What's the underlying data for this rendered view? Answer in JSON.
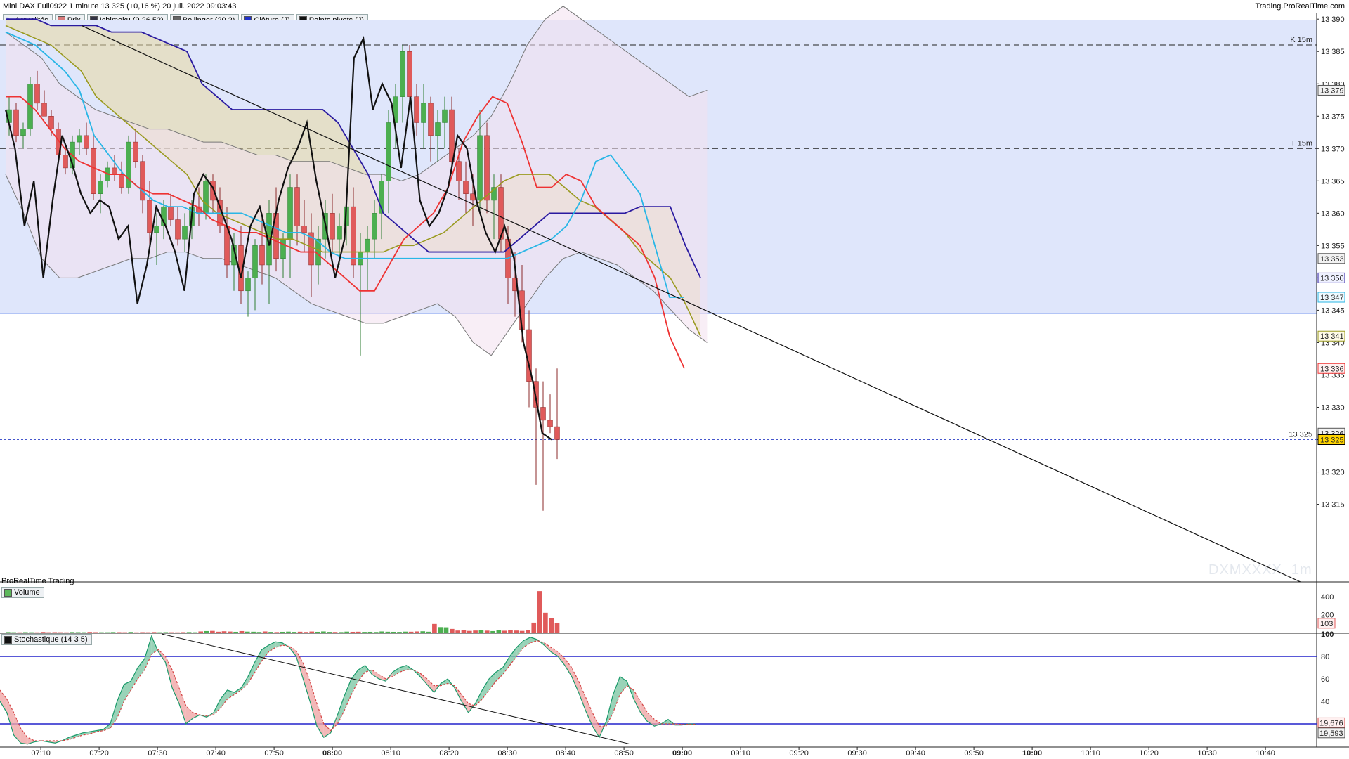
{
  "header": {
    "title": "Mini DAX Full0922 1 minute 13 325 (+0,16 %) 20 juil. 2022 09:03:43",
    "site": "Trading.ProRealTime.com"
  },
  "legend": [
    {
      "label": "Actualités",
      "icon": "refresh-icon",
      "color": "#4a8ad6"
    },
    {
      "label": "Prix",
      "icon": "price-swatch",
      "color": "#d97b7b"
    },
    {
      "label": "Ichimoku (9 26 52)",
      "icon": "ichimoku-swatch",
      "color": "#334"
    },
    {
      "label": "Bollinger (20 2)",
      "icon": "bollinger-swatch",
      "color": "#666666"
    },
    {
      "label": "Clôture (J)",
      "icon": "close-swatch",
      "color": "#2233cc"
    },
    {
      "label": "Points pivots (J)",
      "icon": "pivot-swatch",
      "color": "#111111"
    }
  ],
  "panels": {
    "brand": "ProRealTime Trading",
    "volume_label": "Volume",
    "stoch_label": "Stochastique (14 3 5)"
  },
  "watermark": "DXMXXXX, 1m",
  "levels": {
    "k15": {
      "label": "K 15m",
      "value": 13386
    },
    "t15": {
      "label": "T 15m",
      "value": 13370
    },
    "last": {
      "label": "13 325",
      "value": 13325
    }
  },
  "colors": {
    "up": "#4caf50",
    "down": "#e05a5a",
    "tenkan": "#ee3333",
    "kijun": "#29b6e6",
    "ssa": "#9a9a20",
    "ssb": "#2a1aa0",
    "chikou": "#111111",
    "bollinger": "#777777",
    "stoch_k": "#1a9a6a",
    "stoch_d": "#d44444",
    "band_bg": "#dfe6fb",
    "band_line": "#6688ee"
  },
  "chart_data": [
    {
      "type": "candlestick",
      "title": "Mini DAX Full0922 1 minute",
      "y_ticks": [
        "13 315",
        "13 320",
        "13 325",
        "13 330",
        "13 335",
        "13 340",
        "13 345",
        "13 350",
        "13 355",
        "13 360",
        "13 365",
        "13 370",
        "13 375",
        "13 380",
        "13 385",
        "13 390"
      ],
      "x_ticks": [
        "07:10",
        "07:20",
        "07:30",
        "07:40",
        "07:50",
        "08:00",
        "08:10",
        "08:20",
        "08:30",
        "08:40",
        "08:50",
        "09:00",
        "09:10",
        "09:20",
        "09:30",
        "09:40",
        "09:50",
        "10:00",
        "10:10",
        "10:20",
        "10:30",
        "10:40"
      ],
      "ylim": [
        13303,
        13391
      ],
      "last_price": 13325,
      "price_tags": [
        {
          "text": "13 379",
          "value": 13379,
          "color": "#555555",
          "bg": "#f2f2f2"
        },
        {
          "text": "13 353",
          "value": 13353,
          "color": "#555555",
          "bg": "#f2f2f2"
        },
        {
          "text": "13 350",
          "value": 13350,
          "color": "#2a1aa0",
          "bg": "#eef0ff"
        },
        {
          "text": "13 347",
          "value": 13347,
          "color": "#29b6e6",
          "bg": "#eefaff"
        },
        {
          "text": "13 341",
          "value": 13341,
          "color": "#9a9a20",
          "bg": "#fffbe8"
        },
        {
          "text": "13 336",
          "value": 13336,
          "color": "#ee3333",
          "bg": "#fff0f0"
        },
        {
          "text": "13 326",
          "value": 13326,
          "color": "#555555",
          "bg": "#f2f2f2"
        },
        {
          "text": "13 325",
          "value": 13325,
          "color": "#000000",
          "bg": "#ffd400"
        }
      ],
      "trendline": {
        "from": [
          "07:17",
          13389
        ],
        "to": [
          "10:46",
          13303
        ]
      },
      "tenkan": [
        13378,
        13378,
        13376,
        13373,
        13370,
        13368,
        13367,
        13366,
        13366,
        13364,
        13363,
        13363,
        13362,
        13361,
        13359,
        13358,
        13357,
        13357,
        13356,
        13355,
        13354,
        13354,
        13352,
        13350,
        13348,
        13348,
        13352,
        13356,
        13358,
        13360,
        13364,
        13371,
        13375,
        13378,
        13377,
        13371,
        13364,
        13364,
        13366,
        13365,
        13361,
        13359,
        13357,
        13355,
        13350,
        13341,
        13336
      ],
      "kijun": [
        13388,
        13387,
        13386,
        13384,
        13382,
        13379,
        13372,
        13369,
        13366,
        13364,
        13362,
        13361,
        13361,
        13360,
        13360,
        13360,
        13360,
        13359,
        13358,
        13357,
        13357,
        13356,
        13354,
        13353,
        13353,
        13353,
        13353,
        13353,
        13353,
        13353,
        13353,
        13353,
        13353,
        13353,
        13353,
        13354,
        13355,
        13356,
        13358,
        13362,
        13368,
        13369,
        13366,
        13363,
        13355,
        13347,
        13347
      ],
      "ssa": [
        13389,
        13388,
        13387,
        13386,
        13384,
        13382,
        13378,
        13376,
        13374,
        13372,
        13370,
        13368,
        13366,
        13362,
        13360,
        13359,
        13358,
        13357,
        13356,
        13356,
        13355,
        13354,
        13354,
        13354,
        13354,
        13354,
        13355,
        13355,
        13356,
        13357,
        13359,
        13361,
        13363,
        13365,
        13366,
        13366,
        13366,
        13364,
        13362,
        13361,
        13359,
        13357,
        13354,
        13352,
        13350,
        13346,
        13341
      ],
      "ssb": [
        13390,
        13390,
        13390,
        13389,
        13389,
        13389,
        13389,
        13388,
        13388,
        13388,
        13387,
        13386,
        13385,
        13380,
        13378,
        13376,
        13376,
        13376,
        13376,
        13376,
        13376,
        13376,
        13374,
        13370,
        13366,
        13360,
        13358,
        13356,
        13354,
        13354,
        13354,
        13354,
        13354,
        13354,
        13356,
        13358,
        13360,
        13360,
        13360,
        13360,
        13360,
        13360,
        13361,
        13361,
        13361,
        13355,
        13350
      ],
      "chikou_close": [
        13376,
        13370,
        13358,
        13365,
        13350,
        13362,
        13372,
        13368,
        13363,
        13360,
        13362,
        13361,
        13356,
        13358,
        13346,
        13352,
        13361,
        13358,
        13354,
        13348,
        13363,
        13366,
        13364,
        13360,
        13356,
        13350,
        13358,
        13361,
        13355,
        13362,
        13367,
        13370,
        13374,
        13365,
        13358,
        13350,
        13356,
        13384,
        13387,
        13376,
        13380,
        13377,
        13367,
        13378,
        13362,
        13358,
        13360,
        13364,
        13372,
        13370,
        13362,
        13357,
        13354,
        13358,
        13353,
        13340,
        13334,
        13326,
        13325
      ],
      "bollinger_upper": [
        13388,
        13386,
        13384,
        13380,
        13378,
        13376,
        13375,
        13374,
        13373,
        13373,
        13372,
        13371,
        13371,
        13370,
        13369,
        13369,
        13368,
        13368,
        13368,
        13367,
        13366,
        13366,
        13365,
        13366,
        13368,
        13370,
        13372,
        13375,
        13380,
        13386,
        13390,
        13392,
        13390,
        13388,
        13386,
        13384,
        13382,
        13380,
        13378,
        13379
      ],
      "bollinger_lower": [
        13366,
        13360,
        13353,
        13350,
        13350,
        13351,
        13352,
        13353,
        13353,
        13354,
        13354,
        13353,
        13353,
        13352,
        13351,
        13350,
        13348,
        13346,
        13345,
        13344,
        13343,
        13343,
        13344,
        13345,
        13346,
        13344,
        13340,
        13338,
        13342,
        13346,
        13350,
        13353,
        13354,
        13353,
        13352,
        13350,
        13348,
        13345,
        13342,
        13340
      ],
      "candles_ohlc": [
        [
          13374,
          13378,
          13372,
          13376
        ],
        [
          13376,
          13377,
          13371,
          13372
        ],
        [
          13372,
          13374,
          13370,
          13373
        ],
        [
          13373,
          13381,
          13372,
          13380
        ],
        [
          13380,
          13382,
          13376,
          13377
        ],
        [
          13377,
          13379,
          13375,
          13375
        ],
        [
          13375,
          13376,
          13372,
          13373
        ],
        [
          13373,
          13374,
          13368,
          13369
        ],
        [
          13369,
          13370,
          13366,
          13367
        ],
        [
          13367,
          13372,
          13366,
          13371
        ],
        [
          13371,
          13373,
          13369,
          13372
        ],
        [
          13372,
          13374,
          13369,
          13370
        ],
        [
          13370,
          13372,
          13362,
          13363
        ],
        [
          13363,
          13366,
          13360,
          13365
        ],
        [
          13365,
          13368,
          13364,
          13367
        ],
        [
          13367,
          13369,
          13365,
          13366
        ],
        [
          13366,
          13368,
          13363,
          13364
        ],
        [
          13364,
          13372,
          13363,
          13371
        ],
        [
          13371,
          13373,
          13367,
          13368
        ],
        [
          13368,
          13369,
          13360,
          13362
        ],
        [
          13362,
          13365,
          13355,
          13357
        ],
        [
          13357,
          13360,
          13352,
          13358
        ],
        [
          13358,
          13362,
          13356,
          13361
        ],
        [
          13361,
          13363,
          13358,
          13359
        ],
        [
          13359,
          13361,
          13355,
          13356
        ],
        [
          13356,
          13360,
          13354,
          13358
        ],
        [
          13358,
          13362,
          13356,
          13361
        ],
        [
          13361,
          13364,
          13358,
          13360
        ],
        [
          13360,
          13366,
          13359,
          13365
        ],
        [
          13365,
          13366,
          13360,
          13362
        ],
        [
          13362,
          13364,
          13357,
          13358
        ],
        [
          13358,
          13361,
          13350,
          13352
        ],
        [
          13352,
          13357,
          13348,
          13355
        ],
        [
          13355,
          13358,
          13346,
          13348
        ],
        [
          13348,
          13351,
          13344,
          13350
        ],
        [
          13350,
          13356,
          13345,
          13355
        ],
        [
          13355,
          13360,
          13349,
          13352
        ],
        [
          13352,
          13362,
          13346,
          13360
        ],
        [
          13360,
          13364,
          13351,
          13353
        ],
        [
          13353,
          13357,
          13350,
          13356
        ],
        [
          13356,
          13366,
          13350,
          13364
        ],
        [
          13364,
          13366,
          13355,
          13358
        ],
        [
          13358,
          13362,
          13354,
          13357
        ],
        [
          13357,
          13360,
          13347,
          13352
        ],
        [
          13352,
          13358,
          13349,
          13356
        ],
        [
          13356,
          13362,
          13353,
          13360
        ],
        [
          13360,
          13363,
          13354,
          13356
        ],
        [
          13356,
          13360,
          13352,
          13358
        ],
        [
          13358,
          13362,
          13355,
          13361
        ],
        [
          13361,
          13364,
          13350,
          13352
        ],
        [
          13352,
          13357,
          13338,
          13354
        ],
        [
          13354,
          13358,
          13348,
          13356
        ],
        [
          13356,
          13362,
          13353,
          13360
        ],
        [
          13360,
          13366,
          13356,
          13365
        ],
        [
          13365,
          13376,
          13360,
          13374
        ],
        [
          13374,
          13380,
          13370,
          13378
        ],
        [
          13378,
          13386,
          13374,
          13385
        ],
        [
          13385,
          13386,
          13376,
          13378
        ],
        [
          13378,
          13380,
          13372,
          13374
        ],
        [
          13374,
          13380,
          13370,
          13377
        ],
        [
          13377,
          13378,
          13368,
          13372
        ],
        [
          13372,
          13376,
          13368,
          13374
        ],
        [
          13374,
          13378,
          13370,
          13376
        ],
        [
          13376,
          13378,
          13366,
          13368
        ],
        [
          13368,
          13370,
          13362,
          13365
        ],
        [
          13365,
          13368,
          13360,
          13363
        ],
        [
          13363,
          13366,
          13358,
          13362
        ],
        [
          13362,
          13376,
          13360,
          13372
        ],
        [
          13372,
          13374,
          13360,
          13362
        ],
        [
          13362,
          13366,
          13356,
          13364
        ],
        [
          13364,
          13366,
          13354,
          13356
        ],
        [
          13356,
          13358,
          13346,
          13350
        ],
        [
          13350,
          13354,
          13344,
          13348
        ],
        [
          13348,
          13352,
          13340,
          13342
        ],
        [
          13342,
          13345,
          13330,
          13334
        ],
        [
          13334,
          13336,
          13318,
          13330
        ],
        [
          13330,
          13334,
          13314,
          13328
        ],
        [
          13328,
          13332,
          13326,
          13327
        ],
        [
          13327,
          13336,
          13322,
          13325
        ]
      ]
    },
    {
      "type": "bar",
      "title": "Volume",
      "y_ticks": [
        "200",
        "400"
      ],
      "last_value_tag": "103",
      "values": [
        5,
        3,
        2,
        4,
        3,
        2,
        6,
        3,
        4,
        3,
        2,
        5,
        4,
        3,
        6,
        4,
        3,
        3,
        5,
        4,
        3,
        6,
        2,
        4,
        3,
        5,
        3,
        4,
        3,
        2,
        4,
        5,
        3,
        12,
        16,
        18,
        9,
        14,
        11,
        8,
        16,
        10,
        9,
        6,
        12,
        7,
        5,
        8,
        10,
        7,
        9,
        6,
        11,
        8,
        12,
        7,
        6,
        5,
        10,
        8,
        9,
        7,
        8,
        6,
        12,
        9,
        8,
        7,
        10,
        9,
        12,
        14,
        9,
        95,
        60,
        58,
        40,
        22,
        28,
        18,
        22,
        25,
        21,
        16,
        30,
        20,
        26,
        22,
        18,
        24,
        110,
        460,
        220,
        160,
        103
      ],
      "colors": "mixed"
    },
    {
      "type": "line",
      "title": "Stochastique (14 3 5)",
      "y_ticks": [
        "20",
        "40",
        "60",
        "80",
        "100"
      ],
      "ylim": [
        0,
        100
      ],
      "levels": [
        20,
        80
      ],
      "last_k": "19,676",
      "last_d": "19,593",
      "k": [
        40,
        30,
        10,
        3,
        2,
        4,
        5,
        4,
        3,
        5,
        8,
        10,
        12,
        13,
        14,
        15,
        20,
        40,
        55,
        58,
        70,
        78,
        98,
        84,
        75,
        52,
        38,
        20,
        25,
        28,
        26,
        30,
        42,
        50,
        48,
        52,
        62,
        75,
        86,
        90,
        93,
        92,
        88,
        80,
        60,
        40,
        18,
        8,
        12,
        28,
        45,
        60,
        68,
        72,
        64,
        60,
        58,
        66,
        70,
        72,
        68,
        62,
        55,
        48,
        56,
        60,
        52,
        40,
        30,
        38,
        50,
        60,
        66,
        70,
        80,
        88,
        94,
        97,
        95,
        90,
        84,
        80,
        72,
        62,
        48,
        32,
        18,
        8,
        22,
        46,
        62,
        58,
        42,
        30,
        22,
        18,
        20,
        24,
        19,
        19,
        20,
        19.7
      ],
      "d": [
        50,
        42,
        30,
        16,
        8,
        5,
        5,
        5,
        5,
        5,
        6,
        8,
        10,
        11,
        13,
        14,
        16,
        25,
        40,
        50,
        60,
        68,
        82,
        86,
        80,
        68,
        52,
        36,
        30,
        28,
        27,
        28,
        34,
        42,
        46,
        50,
        56,
        66,
        76,
        84,
        88,
        90,
        89,
        85,
        74,
        58,
        38,
        20,
        14,
        20,
        32,
        46,
        58,
        66,
        68,
        64,
        60,
        62,
        66,
        68,
        68,
        65,
        60,
        54,
        54,
        56,
        54,
        46,
        38,
        36,
        42,
        50,
        58,
        64,
        72,
        80,
        88,
        92,
        94,
        92,
        88,
        84,
        78,
        70,
        58,
        44,
        30,
        18,
        18,
        30,
        46,
        54,
        50,
        40,
        30,
        24,
        20,
        20,
        20,
        19.5,
        19.6,
        19.6
      ],
      "trendline": {
        "from": [
          230,
          100
        ],
        "to": [
          897,
          2
        ]
      }
    }
  ]
}
